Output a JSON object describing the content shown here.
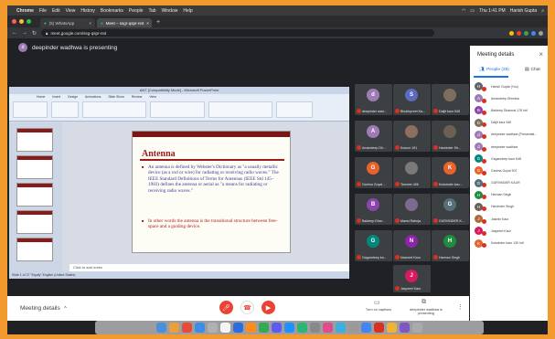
{
  "menubar": {
    "app": "Chrome",
    "items": [
      "File",
      "Edit",
      "View",
      "History",
      "Bookmarks",
      "People",
      "Tab",
      "Window",
      "Help"
    ],
    "clock": "Thu 1:41 PM",
    "user": "Harish Gupta"
  },
  "tabs": [
    {
      "label": "(5) WhatsApp",
      "icon": "whatsapp-icon"
    },
    {
      "label": "Meet – ssgr-qspr-nnt",
      "icon": "meet-icon"
    }
  ],
  "address": {
    "url": "meet.google.com/ssg-qspr-nnt"
  },
  "presenter": {
    "initial": "d",
    "text": "deepinder wadhwa is presenting"
  },
  "ppt": {
    "window_title": "ANT [Compatibility Mode] - Microsoft PowerPoint",
    "ribbon_tabs": [
      "Home",
      "Insert",
      "Design",
      "Animations",
      "Slide Show",
      "Review",
      "View"
    ],
    "slide_title": "Antenna",
    "bullet1": "An antenna is defined by Webster's Dictionary as \"a usually metallic device (as a rod or wire) for radiating or receiving radio waves.\" The IEEE Standard Definitions of Terms for Antennas (IEEE Std 145–1983) defines the antenna or aerial as \"a means for radiating or receiving radio waves.\"",
    "bullet2": "In other words the antenna is the transitional structure between free-space and a guiding device.",
    "notes": "Click to add notes",
    "status": "Slide 1 of 27   \"Equity\"   English (United States)"
  },
  "grid": [
    {
      "name": "deepinder wad...",
      "initial": "d",
      "color": "#9e7bb5"
    },
    {
      "name": "Bhubhpreet Ka...",
      "initial": "S",
      "color": "#5c6bc0"
    },
    {
      "name": "Daljit kaur 545",
      "initial": "",
      "color": "#7d6e5e"
    },
    {
      "name": "Amandeep Dh...",
      "initial": "A",
      "color": "#9e7bb5"
    },
    {
      "name": "Kusum 191",
      "initial": "",
      "color": "#8d6e63"
    },
    {
      "name": "Harvinder Sh...",
      "initial": "",
      "color": "#6d5f52"
    },
    {
      "name": "Garima Goyal ...",
      "initial": "G",
      "color": "#e8622c"
    },
    {
      "name": "Tanveer 406",
      "initial": "",
      "color": "#7a7a7a"
    },
    {
      "name": "Kulwinder kau...",
      "initial": "K",
      "color": "#e8622c"
    },
    {
      "name": "Baldeep Dhar...",
      "initial": "B",
      "color": "#8e44ad"
    },
    {
      "name": "Mansi Raheja",
      "initial": "",
      "color": "#7b6b8f"
    },
    {
      "name": "GURVINDER K...",
      "initial": "G",
      "color": "#546e7a"
    },
    {
      "name": "Gagandeep ka...",
      "initial": "G",
      "color": "#00897b"
    },
    {
      "name": "Navneet Kaur",
      "initial": "N",
      "color": "#8e24aa"
    },
    {
      "name": "Harman Singh",
      "initial": "H",
      "color": "#1e8e3e"
    },
    {
      "name": "Jaspreet Kaur",
      "initial": "J",
      "color": "#d81b60"
    }
  ],
  "bottom": {
    "meeting_details": "Meeting details",
    "captions": "Turn on captions",
    "presenting": "deepinder wadhwa is presenting"
  },
  "panel": {
    "title": "Meeting details",
    "people_tab": "People (28)",
    "chat_tab": "Chat",
    "people": [
      {
        "name": "Harish Gupta (You)",
        "initial": "H",
        "color": "#5f6368"
      },
      {
        "name": "Amandeep Dhindsa",
        "initial": "A",
        "color": "#9e7bb5"
      },
      {
        "name": "Baldeep Dhanrrai 178 Intl",
        "initial": "B",
        "color": "#8e44ad"
      },
      {
        "name": "Daljit kaur 545",
        "initial": "D",
        "color": "#7d6e5e"
      },
      {
        "name": "deepinder wadhwa (Presentati...",
        "initial": "d",
        "color": "#9e7bb5"
      },
      {
        "name": "deepinder wadhwa",
        "initial": "d",
        "color": "#9e7bb5"
      },
      {
        "name": "Gagandeep kaur 648",
        "initial": "G",
        "color": "#00897b"
      },
      {
        "name": "Garima Goyal 303",
        "initial": "G",
        "color": "#e8622c"
      },
      {
        "name": "GURVINDER KAUR",
        "initial": "G",
        "color": "#546e7a"
      },
      {
        "name": "Harman Singh",
        "initial": "H",
        "color": "#1e8e3e"
      },
      {
        "name": "Harvinder Singh",
        "initial": "H",
        "color": "#6d5f52"
      },
      {
        "name": "Jasmin Kaur",
        "initial": "J",
        "color": "#ad6b3a"
      },
      {
        "name": "Jaspreet Kaur",
        "initial": "J",
        "color": "#d81b60"
      },
      {
        "name": "Kulwinder kaur 139 Intl",
        "initial": "K",
        "color": "#e8622c"
      }
    ]
  },
  "colors": {
    "accent": "#1a73e8",
    "mic_off": "#d93025",
    "leave": "#ea4335",
    "slide_title": "#9b1b1b"
  }
}
